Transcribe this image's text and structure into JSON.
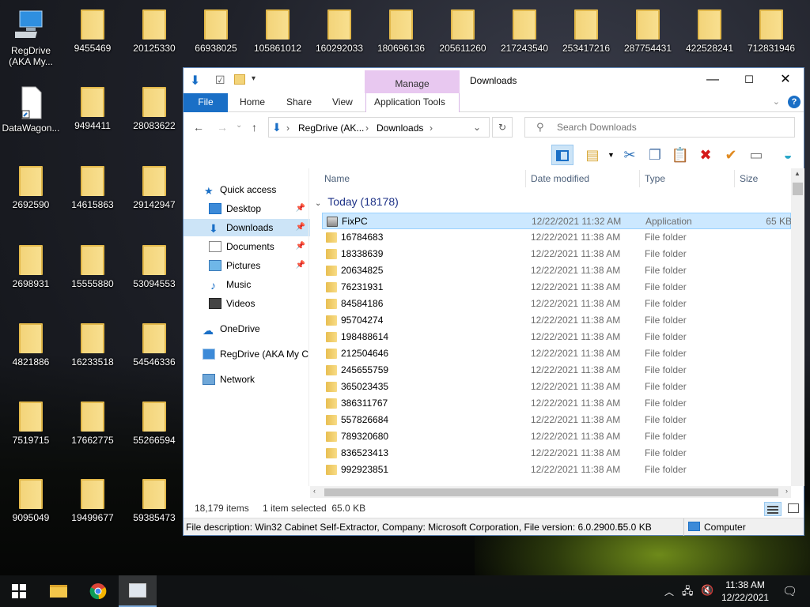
{
  "desktop": {
    "icons": [
      {
        "label": "RegDrive (AKA My...",
        "kind": "computer"
      },
      {
        "label": "DataWagon...",
        "kind": "file"
      },
      {
        "label": "9455469"
      },
      {
        "label": "9494411"
      },
      {
        "label": "14615863"
      },
      {
        "label": "15555880"
      },
      {
        "label": "16233518"
      },
      {
        "label": "17662775"
      },
      {
        "label": "19499677"
      },
      {
        "label": "20125330"
      },
      {
        "label": "28083622"
      },
      {
        "label": "29142947"
      },
      {
        "label": "53094553"
      },
      {
        "label": "54546336"
      },
      {
        "label": "55266594"
      },
      {
        "label": "59385473"
      },
      {
        "label": "2692590"
      },
      {
        "label": "2698931"
      },
      {
        "label": "4821886"
      },
      {
        "label": "7519715"
      },
      {
        "label": "9095049"
      },
      {
        "label": "66938025"
      },
      {
        "label": "105861012"
      },
      {
        "label": "160292033"
      },
      {
        "label": "180696136"
      },
      {
        "label": "205611260"
      },
      {
        "label": "217243540"
      },
      {
        "label": "253417216"
      },
      {
        "label": "287754431"
      },
      {
        "label": "422528241"
      },
      {
        "label": "712831946"
      }
    ]
  },
  "window": {
    "title": "Downloads",
    "context_tab": "Manage",
    "controls": {
      "minimize": "—",
      "maximize": "☐",
      "close": "✕"
    },
    "ribbon_tabs": [
      "File",
      "Home",
      "Share",
      "View",
      "Application Tools"
    ],
    "help": "?",
    "address": {
      "root": "RegDrive (AK...",
      "current": "Downloads"
    },
    "search_placeholder": "Search Downloads",
    "nav": {
      "quick_access": "Quick access",
      "desktop": "Desktop",
      "downloads": "Downloads",
      "documents": "Documents",
      "pictures": "Pictures",
      "music": "Music",
      "videos": "Videos",
      "onedrive": "OneDrive",
      "regdrive": "RegDrive (AKA My Co",
      "network": "Network"
    },
    "columns": {
      "name": "Name",
      "date": "Date modified",
      "type": "Type",
      "size": "Size"
    },
    "group_header": "Today (18178)",
    "files": [
      {
        "name": "FixPC",
        "date": "12/22/2021 11:32 AM",
        "type": "Application",
        "size": "65 KB",
        "selected": true
      },
      {
        "name": "16784683",
        "date": "12/22/2021 11:38 AM",
        "type": "File folder",
        "size": ""
      },
      {
        "name": "18338639",
        "date": "12/22/2021 11:38 AM",
        "type": "File folder",
        "size": ""
      },
      {
        "name": "20634825",
        "date": "12/22/2021 11:38 AM",
        "type": "File folder",
        "size": ""
      },
      {
        "name": "76231931",
        "date": "12/22/2021 11:38 AM",
        "type": "File folder",
        "size": ""
      },
      {
        "name": "84584186",
        "date": "12/22/2021 11:38 AM",
        "type": "File folder",
        "size": ""
      },
      {
        "name": "95704274",
        "date": "12/22/2021 11:38 AM",
        "type": "File folder",
        "size": ""
      },
      {
        "name": "198488614",
        "date": "12/22/2021 11:38 AM",
        "type": "File folder",
        "size": ""
      },
      {
        "name": "212504646",
        "date": "12/22/2021 11:38 AM",
        "type": "File folder",
        "size": ""
      },
      {
        "name": "245655759",
        "date": "12/22/2021 11:38 AM",
        "type": "File folder",
        "size": ""
      },
      {
        "name": "365023435",
        "date": "12/22/2021 11:38 AM",
        "type": "File folder",
        "size": ""
      },
      {
        "name": "386311767",
        "date": "12/22/2021 11:38 AM",
        "type": "File folder",
        "size": ""
      },
      {
        "name": "557826684",
        "date": "12/22/2021 11:38 AM",
        "type": "File folder",
        "size": ""
      },
      {
        "name": "789320680",
        "date": "12/22/2021 11:38 AM",
        "type": "File folder",
        "size": ""
      },
      {
        "name": "836523413",
        "date": "12/22/2021 11:38 AM",
        "type": "File folder",
        "size": ""
      },
      {
        "name": "992923851",
        "date": "12/22/2021 11:38 AM",
        "type": "File folder",
        "size": ""
      }
    ],
    "status": {
      "items": "18,179 items",
      "selected": "1 item selected  65.0 KB"
    },
    "details": {
      "description": "File description: Win32 Cabinet Self-Extractor, Company: Microsoft Corporation, File version: 6.0.2900.5",
      "size": "65.0 KB",
      "location": "Computer"
    }
  },
  "taskbar": {
    "time": "11:38 AM",
    "date": "12/22/2021"
  },
  "colors": {
    "accent": "#1a6fc6",
    "selection": "#cce8ff",
    "context_tab": "#e8c8f0",
    "folder": "#f3d47a"
  }
}
